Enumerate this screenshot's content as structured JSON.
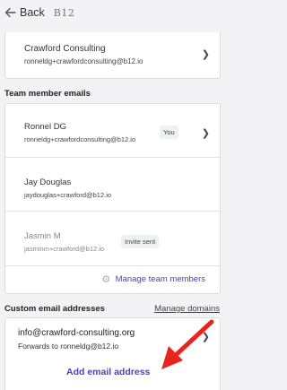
{
  "header": {
    "back_label": "Back",
    "brand": "B12"
  },
  "company": {
    "name": "Crawford Consulting",
    "email": "ronneldg+crawfordconsulting@b12.io"
  },
  "team": {
    "title": "Team member emails",
    "members": [
      {
        "name": "Ronnel DG",
        "email": "ronneldg+crawfordconsulting@b12.io",
        "badge": "You"
      },
      {
        "name": "Jay Douglas",
        "email": "jaydouglas+crawford@b12.io"
      },
      {
        "name": "Jasmin M",
        "email": "jasminm+crawford@b12.io",
        "badge": "Invite sent"
      }
    ],
    "manage_label": "Manage team members"
  },
  "custom": {
    "title": "Custom email addresses",
    "manage_domains_label": "Manage domains",
    "address": "info@crawford-consulting.org",
    "forwards": "Forwards to ronneldg@b12.io",
    "add_label": "Add email address"
  },
  "colors": {
    "accent": "#4a3fc2",
    "annotation_arrow": "#e8241c"
  }
}
